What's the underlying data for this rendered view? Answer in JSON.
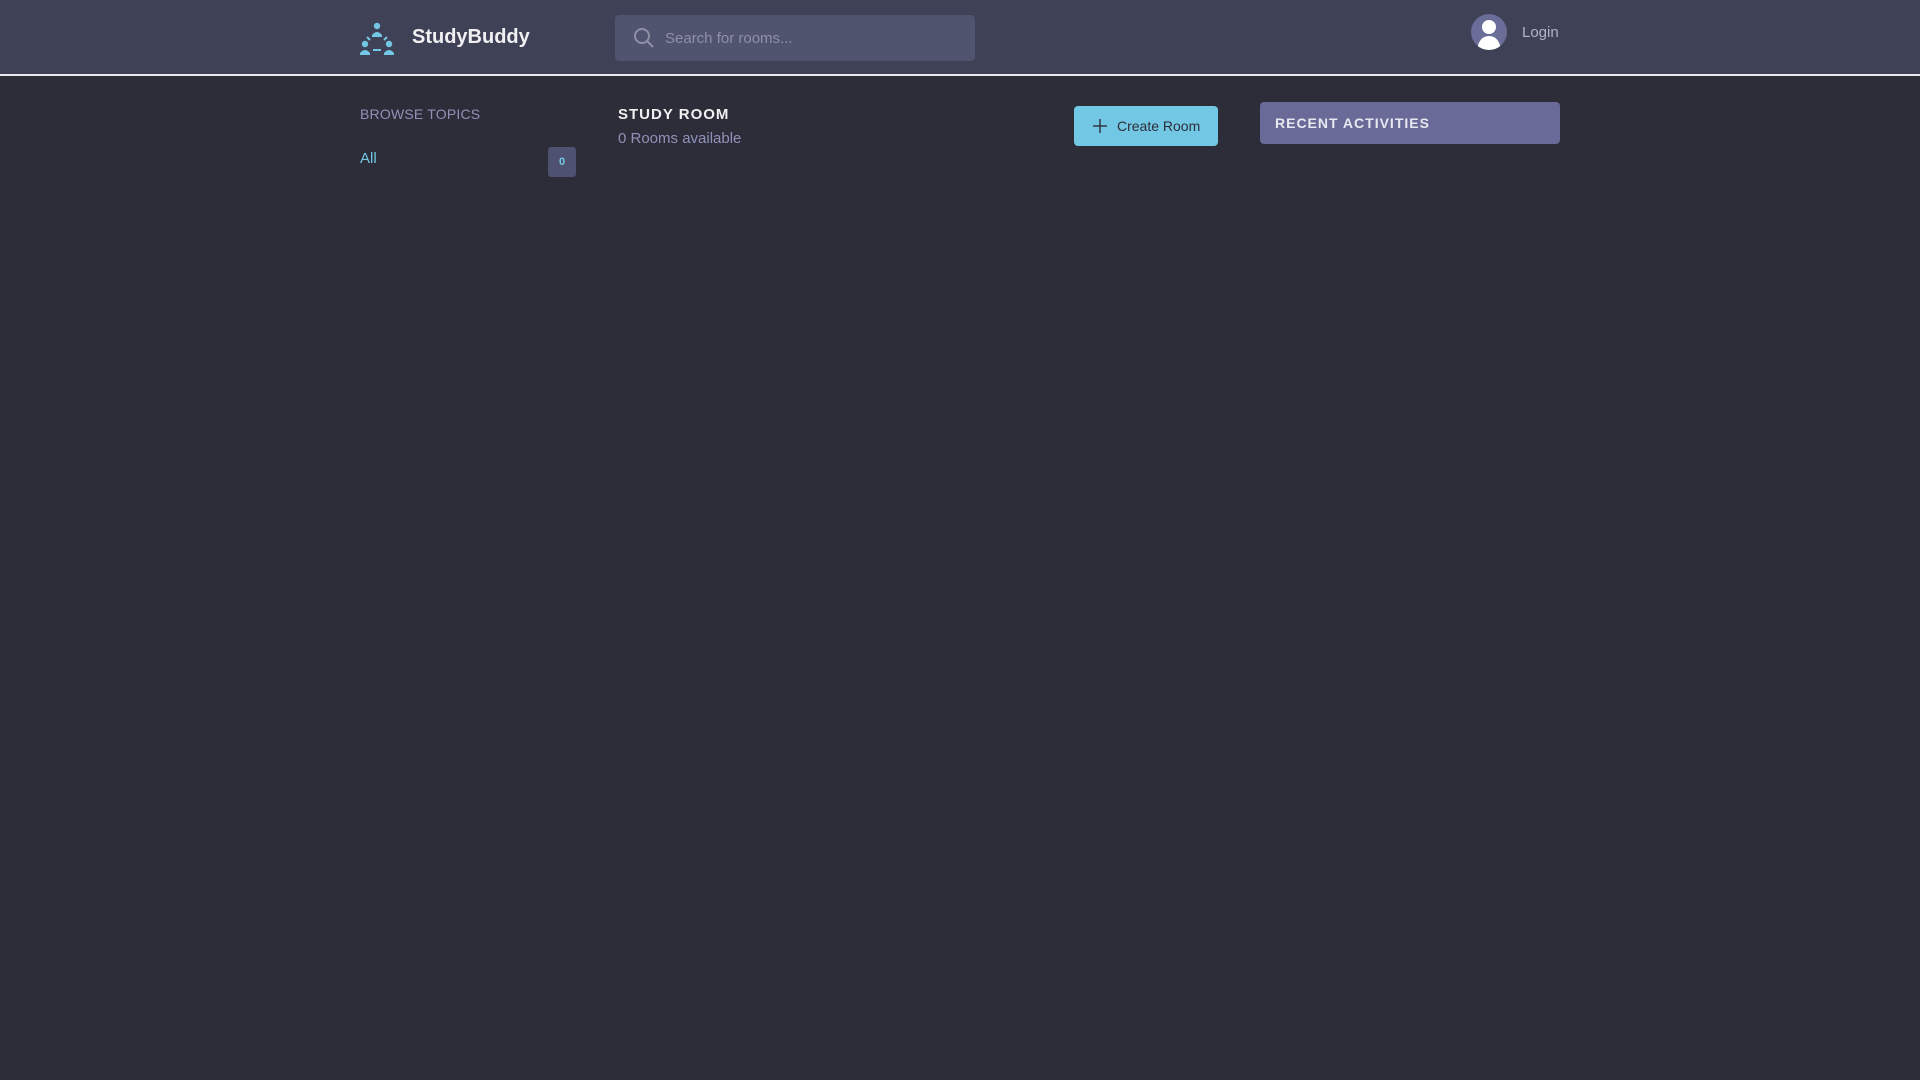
{
  "header": {
    "app_title": "StudyBuddy",
    "search_placeholder": "Search for rooms...",
    "login_label": "Login"
  },
  "sidebar": {
    "title": "BROWSE TOPICS",
    "topics": [
      {
        "label": "All",
        "count": "0"
      }
    ]
  },
  "main": {
    "title": "STUDY ROOM",
    "rooms_available": "0 Rooms available",
    "create_button_label": "Create Room"
  },
  "activity": {
    "title": "RECENT ACTIVITIES"
  },
  "colors": {
    "background": "#2d2d39",
    "header": "#3f4156",
    "accent": "#72c8e4",
    "muted_text": "#8f91b8",
    "panel_header": "#696a98"
  },
  "icons": [
    "logo-icon",
    "search-icon",
    "avatar-icon",
    "plus-icon"
  ]
}
